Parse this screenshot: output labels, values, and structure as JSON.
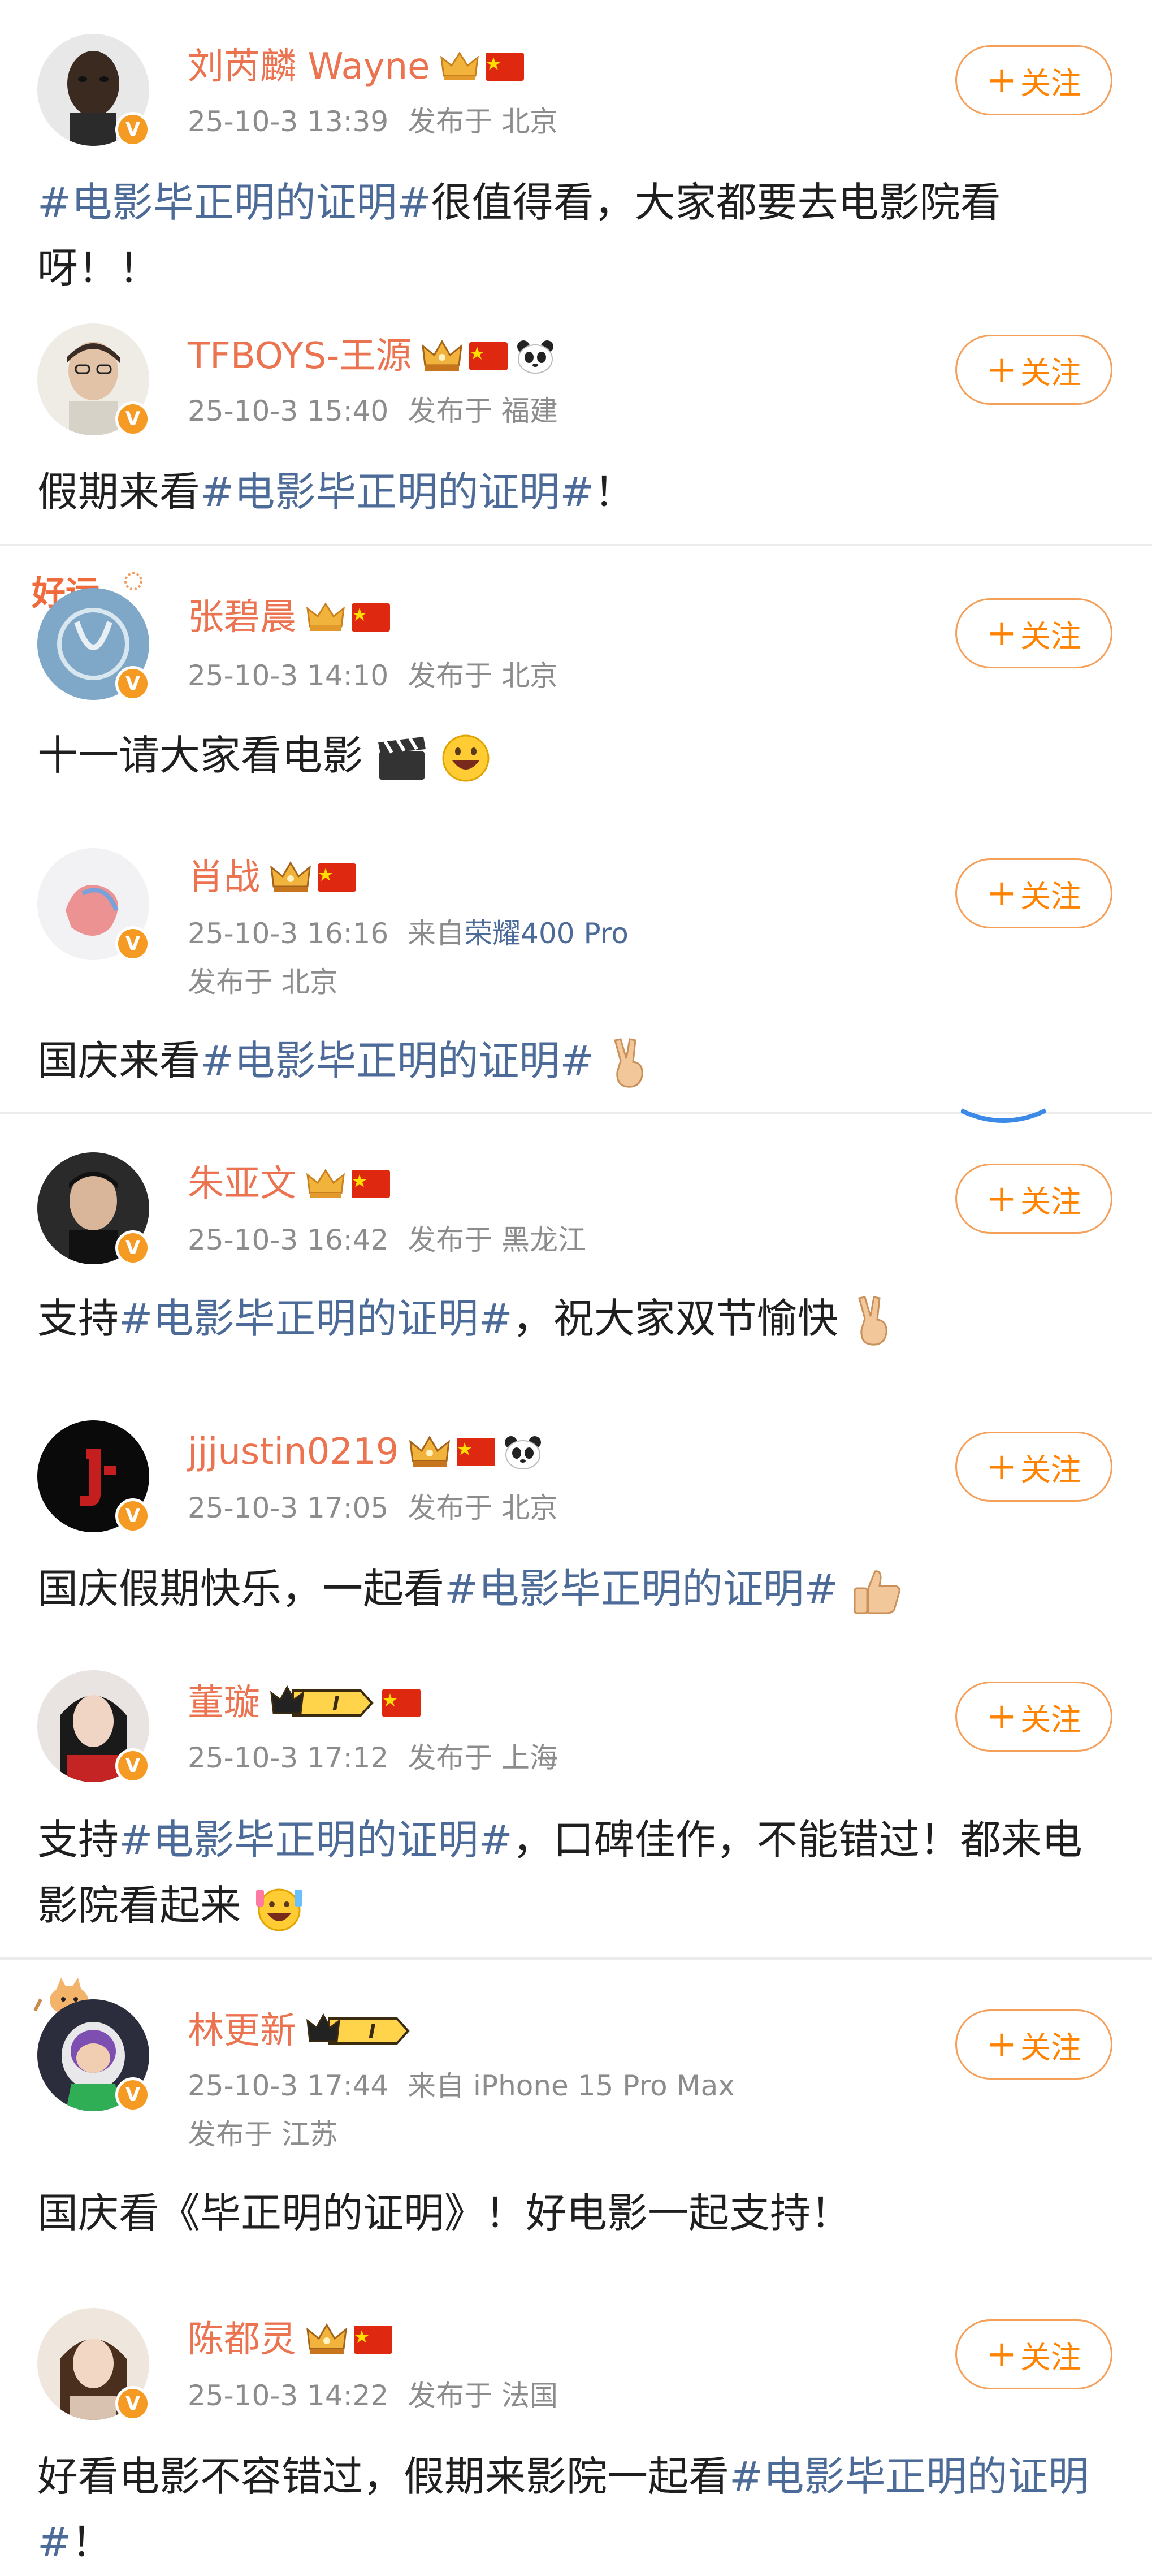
{
  "follow_label": "关注",
  "posts": [
    {
      "name": "刘芮麟 Wayne",
      "time": "25-10-3 13:39",
      "location": "发布于 北京",
      "text_before": "",
      "hashtag": "#电影毕正明的证明#",
      "text_after": "很值得看，大家都要去电影院看呀！！"
    },
    {
      "name": "TFBOYS-王源",
      "time": "25-10-3 15:40",
      "location": "发布于 福建",
      "text_before": "假期来看",
      "hashtag": "#电影毕正明的证明#",
      "text_after": "！"
    },
    {
      "name": "张碧晨",
      "time": "25-10-3 14:10",
      "location": "发布于 北京",
      "text": "十一请大家看电影"
    },
    {
      "name": "肖战",
      "time": "25-10-3 16:16",
      "source_prefix": "来自",
      "device": "荣耀400 Pro",
      "location": "发布于 北京",
      "text_before": "国庆来看",
      "hashtag": "#电影毕正明的证明#",
      "text_after": ""
    },
    {
      "name": "朱亚文",
      "time": "25-10-3 16:42",
      "location": "发布于 黑龙江",
      "text_before": "支持",
      "hashtag": "#电影毕正明的证明#",
      "text_after": "，祝大家双节愉快"
    },
    {
      "name": "jjjustin0219",
      "time": "25-10-3 17:05",
      "location": "发布于 北京",
      "text_before": "国庆假期快乐，一起看",
      "hashtag": "#电影毕正明的证明#",
      "text_after": ""
    },
    {
      "name": "董璇",
      "time": "25-10-3 17:12",
      "location": "发布于 上海",
      "text_before": "支持",
      "hashtag": "#电影毕正明的证明#",
      "text_after": "，口碑佳作，不能错过！都来电影院看起来"
    },
    {
      "name": "林更新",
      "time": "25-10-3 17:44",
      "device_line": "来自 iPhone 15 Pro Max",
      "location": "发布于 江苏",
      "text": "国庆看《毕正明的证明》！好电影一起支持！"
    },
    {
      "name": "陈都灵",
      "time": "25-10-3 14:22",
      "location": "发布于 法国",
      "text_before": "好看电影不容错过，假期来影院一起看",
      "hashtag": "#电影毕正明的证明#",
      "text_after": "！"
    }
  ],
  "colors": {
    "name": "#eb7350",
    "hashtag": "#4d6b98",
    "meta": "#8c8c8c",
    "follow": "#ff8200",
    "badge": "#f59a23"
  },
  "icons": [
    "verified-v-badge",
    "crown-icon",
    "china-flag-icon",
    "panda-icon",
    "plus-icon",
    "clapperboard-emoji",
    "grinning-emoji",
    "victory-hand-emoji",
    "thumbs-up-emoji",
    "party-emoji"
  ]
}
